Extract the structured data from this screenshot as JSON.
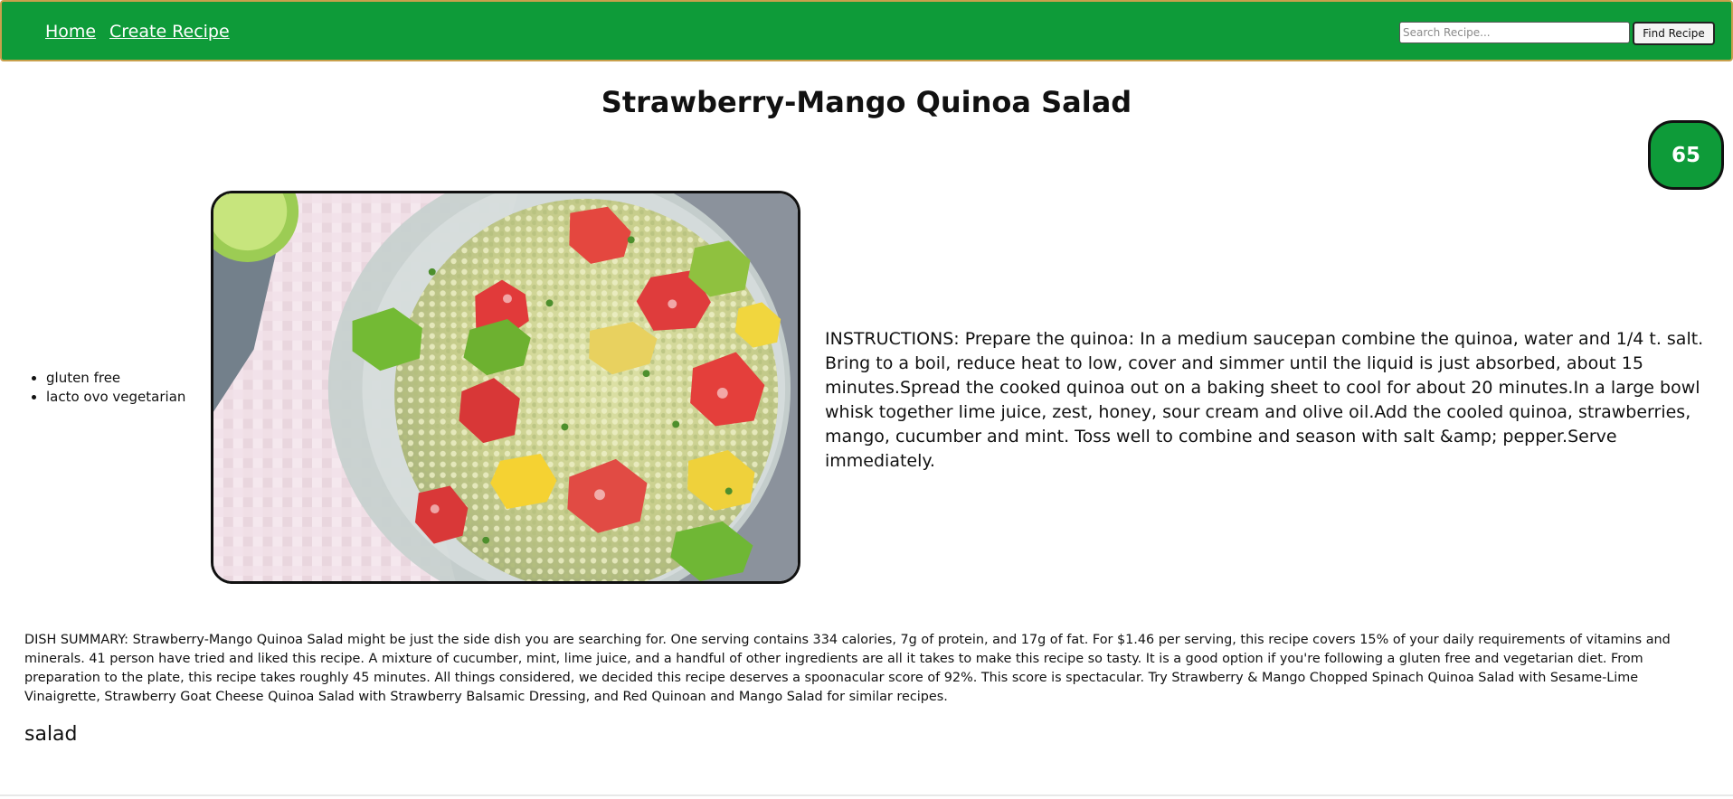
{
  "nav": {
    "home_label": "Home",
    "create_label": "Create Recipe",
    "search_placeholder": "Search Recipe...",
    "search_button_label": "Find Recipe"
  },
  "recipe": {
    "title": "Strawberry-Mango Quinoa Salad",
    "score": "65",
    "diets": [
      "gluten free",
      "lacto ovo vegetarian"
    ],
    "instructions": "INSTRUCTIONS: Prepare the quinoa: In a medium saucepan combine the quinoa, water and 1/4 t. salt. Bring to a boil, reduce heat to low, cover and simmer until the liquid is just absorbed, about 15 minutes.Spread the cooked quinoa out on a baking sheet to cool for about 20 minutes.In a large bowl whisk together lime juice, zest, honey, sour cream and olive oil.Add the cooled quinoa, strawberries, mango, cucumber and mint. Toss well to combine and season with salt &amp; pepper.Serve immediately.",
    "summary": "DISH SUMMARY: Strawberry-Mango Quinoa Salad might be just the side dish you are searching for. One serving contains 334 calories, 7g of protein, and 17g of fat. For $1.46 per serving, this recipe covers 15% of your daily requirements of vitamins and minerals. 41 person have tried and liked this recipe. A mixture of cucumber, mint, lime juice, and a handful of other ingredients are all it takes to make this recipe so tasty. It is a good option if you're following a gluten free and vegetarian diet. From preparation to the plate, this recipe takes roughly 45 minutes. All things considered, we decided this recipe deserves a spoonacular score of 92%. This score is spectacular. Try Strawberry & Mango Chopped Spinach Quinoa Salad with Sesame-Lime Vinaigrette, Strawberry Goat Cheese Quinoa Salad with Strawberry Balsamic Dressing, and Red Quinoan and Mango Salad for similar recipes.",
    "dish_type": "salad"
  },
  "icons": {
    "recipe_image": "quinoa-salad-photo"
  },
  "colors": {
    "nav_bar": "#0e9b39",
    "badge": "#0e9b39",
    "nav_border": "#c8a04c"
  }
}
